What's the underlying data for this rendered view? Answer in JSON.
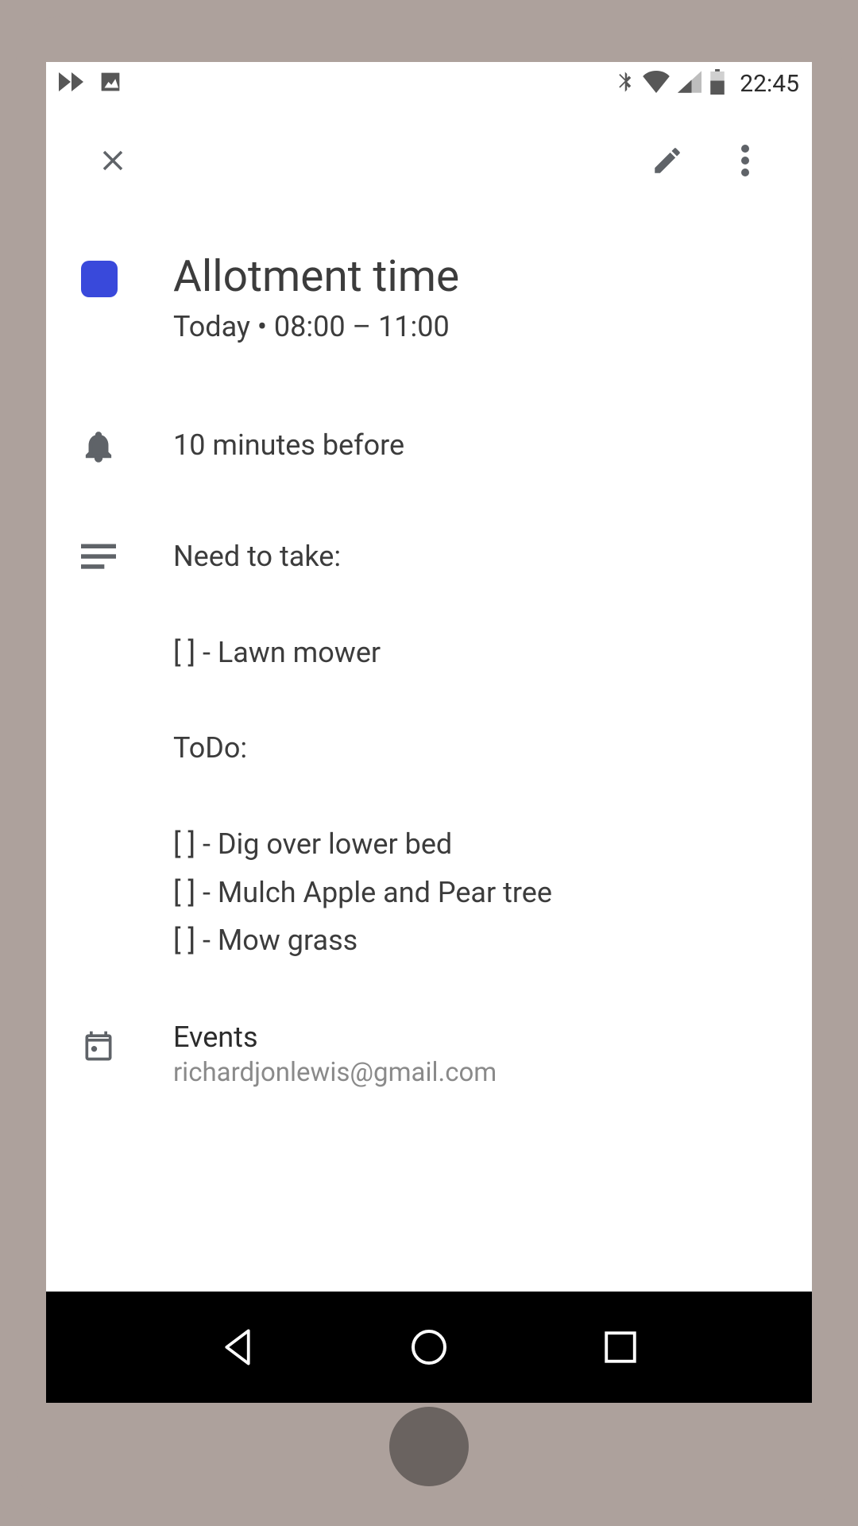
{
  "status": {
    "time": "22:45"
  },
  "event": {
    "title": "Allotment time",
    "time_line": "Today  •  08:00 – 11:00",
    "color": "#3949db"
  },
  "notification": "10 minutes before",
  "notes": "Need to take:\n\n[  ] - Lawn mower\n\nToDo:\n\n[  ] - Dig over lower bed\n[  ] - Mulch Apple and Pear tree\n[  ] - Mow grass",
  "calendar": {
    "name": "Events",
    "email": "richardjonlewis@gmail.com"
  }
}
